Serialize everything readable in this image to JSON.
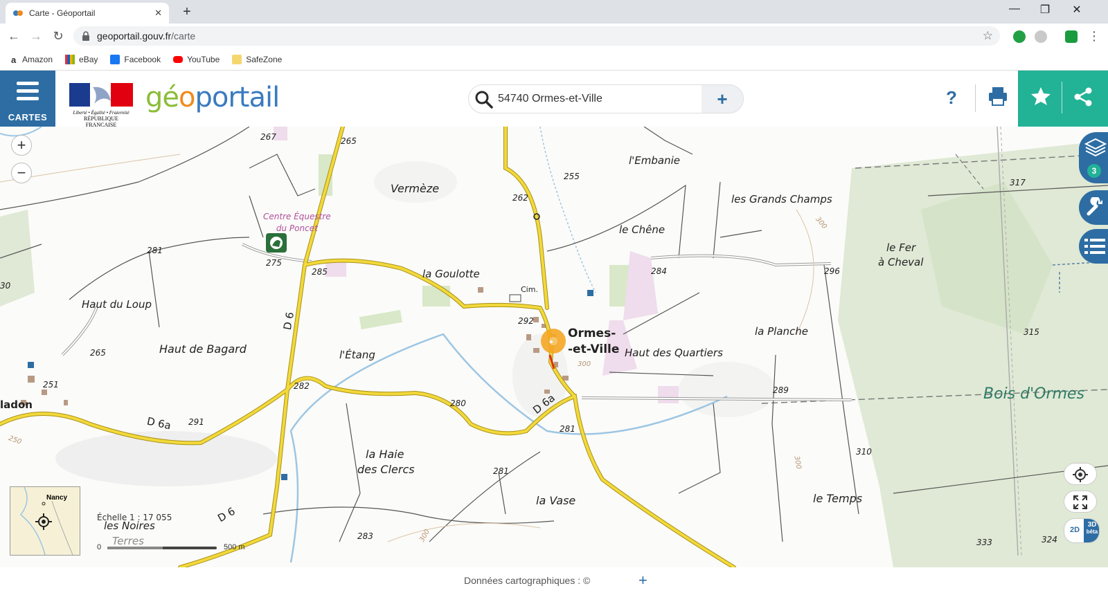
{
  "browser": {
    "tab_title": "Carte - Géoportail",
    "tab_close": "✕",
    "new_tab": "+",
    "url_host": "geoportail.gouv.fr",
    "url_path": "/carte",
    "window_min": "—",
    "window_max": "❐",
    "window_close": "✕"
  },
  "bookmarks": [
    {
      "label": "Amazon"
    },
    {
      "label": "eBay"
    },
    {
      "label": "Facebook"
    },
    {
      "label": "YouTube"
    },
    {
      "label": "SafeZone"
    }
  ],
  "header": {
    "menu_label": "CARTES",
    "republique_line1": "Liberté • Égalité • Fraternité",
    "republique_line2": "RÉPUBLIQUE FRANÇAISE",
    "logo_ge": "gé",
    "logo_o": "o",
    "logo_rest": "portail",
    "search_value": "54740 Ormes-et-Ville",
    "search_add": "+",
    "help": "?"
  },
  "map": {
    "places": {
      "vermeze": "Vermèze",
      "embanie": "l'Embanie",
      "grands_champs": "les Grands Champs",
      "chene": "le Chêne",
      "fer_cheval_1": "le Fer",
      "fer_cheval_2": "à Cheval",
      "goulotte": "la Goulotte",
      "haut_loup": "Haut du Loup",
      "haut_bagard": "Haut de Bagard",
      "etang": "l'Étang",
      "ormes_1": "Ormes-",
      "ormes_2": "-et-Ville",
      "haut_quartiers": "Haut des Quartiers",
      "planche": "la Planche",
      "bois_ormes": "Bois d'Ormes",
      "haie_clercs_1": "la Haie",
      "haie_clercs_2": "des Clercs",
      "vase": "la Vase",
      "temps": "le Temps",
      "noires_1": "les Noires",
      "noires_2": "Terres",
      "nadon": "ladon",
      "equestre_1": "Centre Équestre",
      "equestre_2": "du Poncet",
      "cim": "Cim."
    },
    "roads": {
      "d6_a": "D 6",
      "d6_b": "D 6",
      "d6a_a": "D 6a",
      "d6a_b": "D 6a"
    },
    "altitudes": {
      "a267": "267",
      "a265": "265",
      "a262": "262",
      "a255": "255",
      "a317": "317",
      "a300a": "300",
      "a281a": "281",
      "a275": "275",
      "a285": "285",
      "a284": "284",
      "a296": "296",
      "a292": "292",
      "a265b": "265",
      "a315": "315",
      "a300b": "300",
      "a251": "251",
      "a282": "282",
      "a280": "280",
      "a289": "289",
      "a291": "291",
      "a250": "250",
      "a281b": "281",
      "a310": "310",
      "a281c": "281",
      "a300c": "300",
      "a283": "283",
      "a300d": "300",
      "a333": "333",
      "a324": "324",
      "a30": "30"
    },
    "layers_count": "3",
    "scale_text": "Échelle 1 : 17 055",
    "scale_zero": "0",
    "scale_end": "500 m",
    "minimap_label": "Nancy",
    "view_2d": "2D",
    "view_3d": "3D",
    "view_beta": "bêta"
  },
  "footer": {
    "credits": "Données cartographiques : ©",
    "plus": "+"
  },
  "colors": {
    "primary_blue": "#2d6da3",
    "teal": "#22b296",
    "road_yellow": "#f2d93a",
    "forest_green": "#dfe9d5"
  }
}
